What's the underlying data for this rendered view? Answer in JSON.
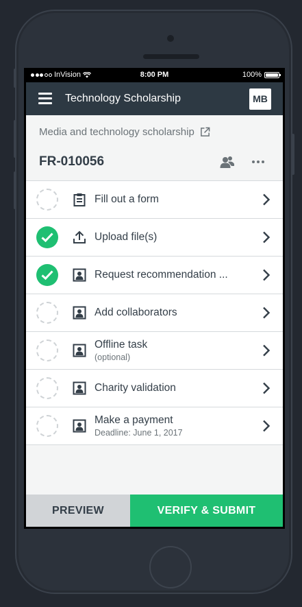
{
  "status_bar": {
    "carrier": "InVision",
    "time": "8:00 PM",
    "battery": "100%",
    "icons": [
      "signal-dots-icon",
      "wifi-icon",
      "battery-icon"
    ]
  },
  "header": {
    "title": "Technology Scholarship",
    "avatar_initials": "MB",
    "menu_icon": "hamburger-menu-icon"
  },
  "record": {
    "program_link": "Media and technology scholarship",
    "id": "FR-010056"
  },
  "tasks": [
    {
      "label": "Fill out a form",
      "sub": "",
      "status": "incomplete",
      "icon": "clipboard-icon"
    },
    {
      "label": "Upload file(s)",
      "sub": "",
      "status": "complete",
      "icon": "upload-icon"
    },
    {
      "label": "Request recommendation ...",
      "sub": "",
      "status": "complete",
      "icon": "portrait-icon"
    },
    {
      "label": "Add collaborators",
      "sub": "",
      "status": "incomplete",
      "icon": "portrait-icon"
    },
    {
      "label": "Offline task",
      "sub": "(optional)",
      "status": "incomplete",
      "icon": "portrait-icon"
    },
    {
      "label": "Charity validation",
      "sub": "",
      "status": "incomplete",
      "icon": "portrait-icon"
    },
    {
      "label": "Make a payment",
      "sub": "Deadline: June 1, 2017",
      "status": "incomplete",
      "icon": "portrait-icon"
    }
  ],
  "footer": {
    "preview_label": "PREVIEW",
    "submit_label": "VERIFY & SUBMIT"
  },
  "colors": {
    "header_bg": "#2d3943",
    "accent_green": "#1fbf72",
    "phone_body": "#2c323b"
  }
}
